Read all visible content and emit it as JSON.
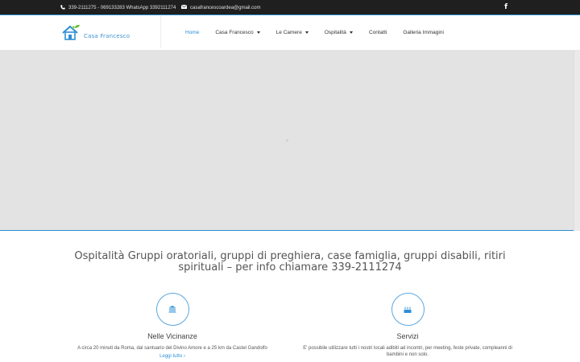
{
  "topbar": {
    "phone_text": "339-2111275 - 069133283 WhatsApp 3392111274",
    "email_text": "casafrancescoardea@gmail.com",
    "social_icon": "facebook-icon",
    "social_glyph": "f"
  },
  "logo": {
    "text": "Casa Francesco"
  },
  "nav": {
    "items": [
      {
        "label": "Home",
        "active": true
      },
      {
        "label": "Casa Francesco"
      },
      {
        "label": "Le Camere"
      },
      {
        "label": "Ospitalità"
      },
      {
        "label": "Contatti"
      },
      {
        "label": "Galleria Immagini"
      }
    ]
  },
  "headline": "Ospitalità Gruppi oratoriali, gruppi di preghiera, case famiglia, gruppi disabili, ritiri spirituali – per info chiamare 339-2111274",
  "features": [
    {
      "icon": "bank-icon",
      "title": "Nelle Vicinanze",
      "description": "A circa 20 minuti da Roma, dal santuario del Divino Amore e a 25 km da Castel Gandolfo",
      "link": "Leggi tutto ›"
    },
    {
      "icon": "birthday-cake-icon",
      "title": "Servizi",
      "description": "E' possibile utilizzare tutti i nostri locali adibiti ad incontri, per meeting, feste private, compleanni di bambini e non solo."
    }
  ],
  "colors": {
    "accent": "#2e8fd6",
    "topbar_bg": "#1f1f1f",
    "hero_bg": "#e3e3e3"
  }
}
